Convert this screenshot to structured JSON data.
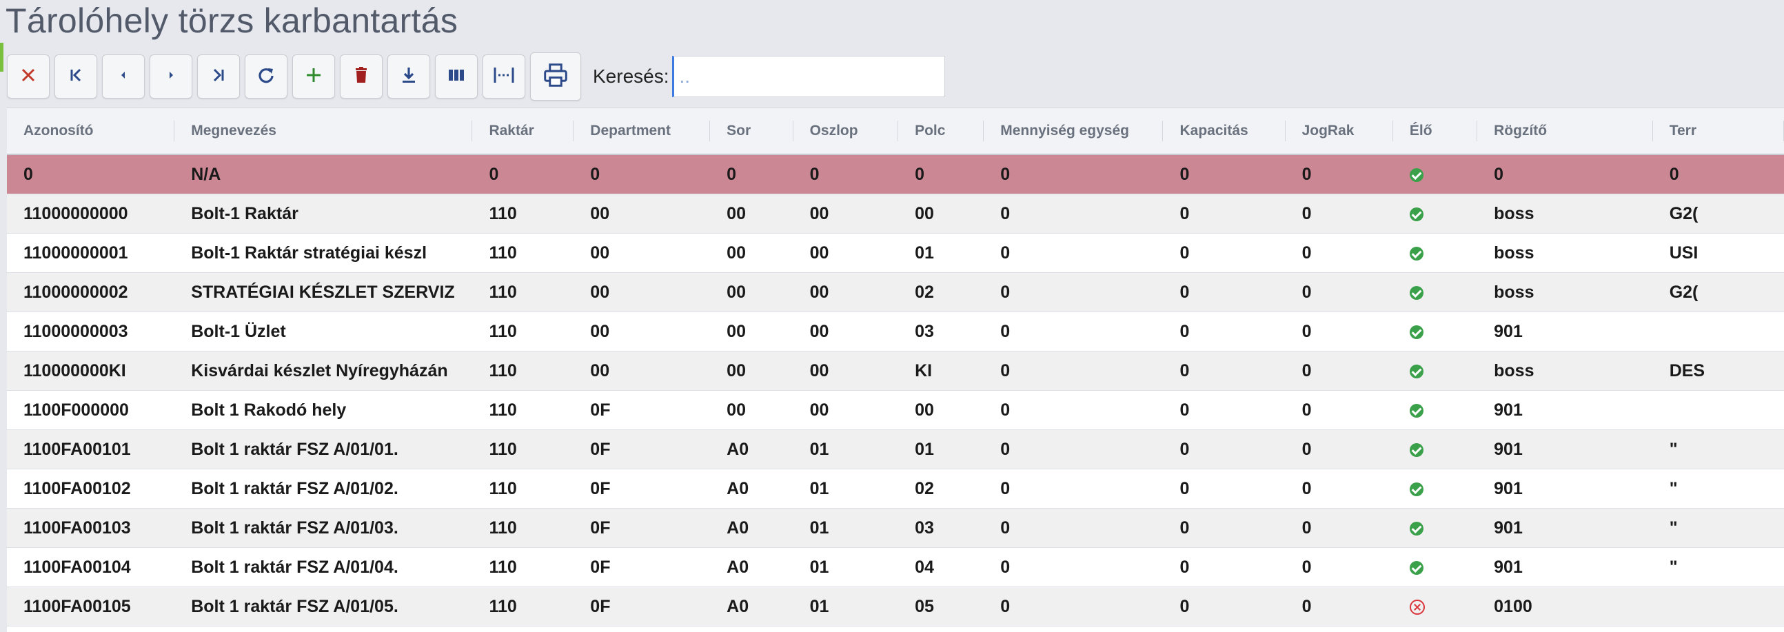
{
  "page": {
    "title": "Tárolóhely törzs karbantartás"
  },
  "toolbar": {
    "buttons": [
      {
        "name": "close-icon",
        "color": "#c0392b"
      },
      {
        "name": "first-page-icon",
        "color": "#2c4a8a"
      },
      {
        "name": "prev-page-icon",
        "color": "#2c4a8a"
      },
      {
        "name": "next-page-icon",
        "color": "#2c4a8a"
      },
      {
        "name": "last-page-icon",
        "color": "#2c4a8a"
      },
      {
        "name": "refresh-icon",
        "color": "#2c4a8a"
      },
      {
        "name": "add-icon",
        "color": "#2e8b2e"
      },
      {
        "name": "delete-icon",
        "color": "#a11f1f"
      },
      {
        "name": "download-icon",
        "color": "#2c4a8a"
      },
      {
        "name": "columns-icon",
        "color": "#2c4a8a"
      },
      {
        "name": "fit-columns-icon",
        "color": "#2c4a8a"
      },
      {
        "name": "print-icon",
        "color": "#2c4a8a"
      }
    ],
    "search_label": "Keresés:",
    "search_placeholder": "..",
    "search_value": ""
  },
  "grid": {
    "columns": [
      "Azonosító",
      "Megnevezés",
      "Raktár",
      "Department",
      "Sor",
      "Oszlop",
      "Polc",
      "Mennyiség egység",
      "Kapacitás",
      "JogRak",
      "Élő",
      "Rögzítő",
      "Terr"
    ],
    "rows": [
      {
        "id": "0",
        "name": "N/A",
        "raktar": "0",
        "dept": "0",
        "sor": "0",
        "oszlop": "0",
        "polc": "0",
        "menny": "0",
        "kap": "0",
        "jograk": "0",
        "elo": "ok",
        "rogzito": "0",
        "terr": "0",
        "selected": true
      },
      {
        "id": "11000000000",
        "name": "Bolt-1 Raktár",
        "raktar": "110",
        "dept": "00",
        "sor": "00",
        "oszlop": "00",
        "polc": "00",
        "menny": "0",
        "kap": "0",
        "jograk": "0",
        "elo": "ok",
        "rogzito": "boss",
        "terr": "G2("
      },
      {
        "id": "11000000001",
        "name": "Bolt-1 Raktár stratégiai készl",
        "raktar": "110",
        "dept": "00",
        "sor": "00",
        "oszlop": "00",
        "polc": "01",
        "menny": "0",
        "kap": "0",
        "jograk": "0",
        "elo": "ok",
        "rogzito": "boss",
        "terr": "USI"
      },
      {
        "id": "11000000002",
        "name": "STRATÉGIAI KÉSZLET SZERVIZ",
        "raktar": "110",
        "dept": "00",
        "sor": "00",
        "oszlop": "00",
        "polc": "02",
        "menny": "0",
        "kap": "0",
        "jograk": "0",
        "elo": "ok",
        "rogzito": "boss",
        "terr": "G2("
      },
      {
        "id": "11000000003",
        "name": "Bolt-1 Üzlet",
        "raktar": "110",
        "dept": "00",
        "sor": "00",
        "oszlop": "00",
        "polc": "03",
        "menny": "0",
        "kap": "0",
        "jograk": "0",
        "elo": "ok",
        "rogzito": "901",
        "terr": ""
      },
      {
        "id": "110000000KI",
        "name": "Kisvárdai készlet Nyíregyházán",
        "raktar": "110",
        "dept": "00",
        "sor": "00",
        "oszlop": "00",
        "polc": "KI",
        "menny": "0",
        "kap": "0",
        "jograk": "0",
        "elo": "ok",
        "rogzito": "boss",
        "terr": "DES"
      },
      {
        "id": "1100F000000",
        "name": "Bolt 1 Rakodó hely",
        "raktar": "110",
        "dept": "0F",
        "sor": "00",
        "oszlop": "00",
        "polc": "00",
        "menny": "0",
        "kap": "0",
        "jograk": "0",
        "elo": "ok",
        "rogzito": "901",
        "terr": ""
      },
      {
        "id": "1100FA00101",
        "name": "Bolt 1 raktár FSZ A/01/01.",
        "raktar": "110",
        "dept": "0F",
        "sor": "A0",
        "oszlop": "01",
        "polc": "01",
        "menny": "0",
        "kap": "0",
        "jograk": "0",
        "elo": "ok",
        "rogzito": "901",
        "terr": "\""
      },
      {
        "id": "1100FA00102",
        "name": "Bolt 1 raktár FSZ A/01/02.",
        "raktar": "110",
        "dept": "0F",
        "sor": "A0",
        "oszlop": "01",
        "polc": "02",
        "menny": "0",
        "kap": "0",
        "jograk": "0",
        "elo": "ok",
        "rogzito": "901",
        "terr": "\""
      },
      {
        "id": "1100FA00103",
        "name": "Bolt 1 raktár FSZ A/01/03.",
        "raktar": "110",
        "dept": "0F",
        "sor": "A0",
        "oszlop": "01",
        "polc": "03",
        "menny": "0",
        "kap": "0",
        "jograk": "0",
        "elo": "ok",
        "rogzito": "901",
        "terr": "\""
      },
      {
        "id": "1100FA00104",
        "name": "Bolt 1 raktár FSZ A/01/04.",
        "raktar": "110",
        "dept": "0F",
        "sor": "A0",
        "oszlop": "01",
        "polc": "04",
        "menny": "0",
        "kap": "0",
        "jograk": "0",
        "elo": "ok",
        "rogzito": "901",
        "terr": "\""
      },
      {
        "id": "1100FA00105",
        "name": "Bolt 1 raktár FSZ A/01/05.",
        "raktar": "110",
        "dept": "0F",
        "sor": "A0",
        "oszlop": "01",
        "polc": "05",
        "menny": "0",
        "kap": "0",
        "jograk": "0",
        "elo": "bad",
        "rogzito": "0100",
        "terr": ""
      }
    ]
  }
}
